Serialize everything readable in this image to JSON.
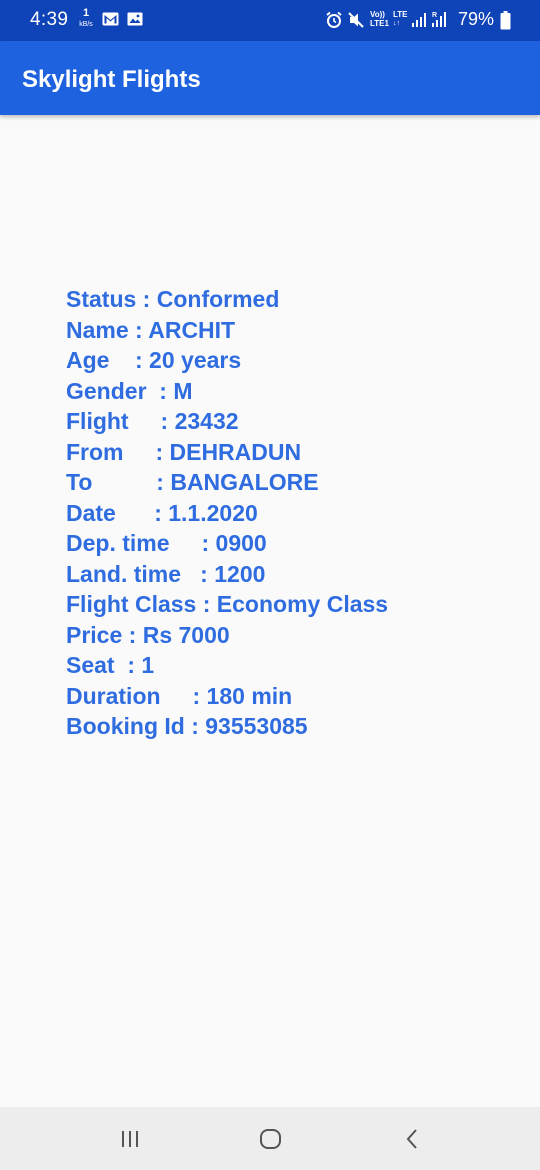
{
  "status_bar": {
    "time": "4:39",
    "net_speed_value": "1",
    "net_speed_unit": "kB/s",
    "lte_label": "LTE",
    "volte_label": "Vo))",
    "lte1_label": "LTE1",
    "battery_percent": "79%",
    "icons": [
      "gmail-icon",
      "gallery-icon",
      "alarm-icon",
      "mute-icon",
      "signal-icon",
      "roaming-signal-icon",
      "battery-icon"
    ]
  },
  "app_bar": {
    "title": "Skylight Flights"
  },
  "booking": {
    "lines": [
      "Status : Conformed",
      "Name : ARCHIT",
      "Age    : 20 years",
      "Gender  : M",
      "Flight     : 23432",
      "From     : DEHRADUN",
      "To          : BANGALORE",
      "Date      : 1.1.2020",
      "Dep. time     : 0900",
      "Land. time   : 1200",
      "Flight Class : Economy Class",
      "Price : Rs 7000",
      "Seat  : 1",
      "Duration     : 180 min",
      "Booking Id : 93553085"
    ]
  },
  "nav_bar": {
    "buttons": [
      "recents-icon",
      "home-icon",
      "back-icon"
    ]
  },
  "colors": {
    "status_bar": "#0f43b8",
    "app_bar": "#1f62e0",
    "text_accent": "#2f6ce0",
    "background": "#fafafa",
    "nav_bar": "#ededed"
  }
}
